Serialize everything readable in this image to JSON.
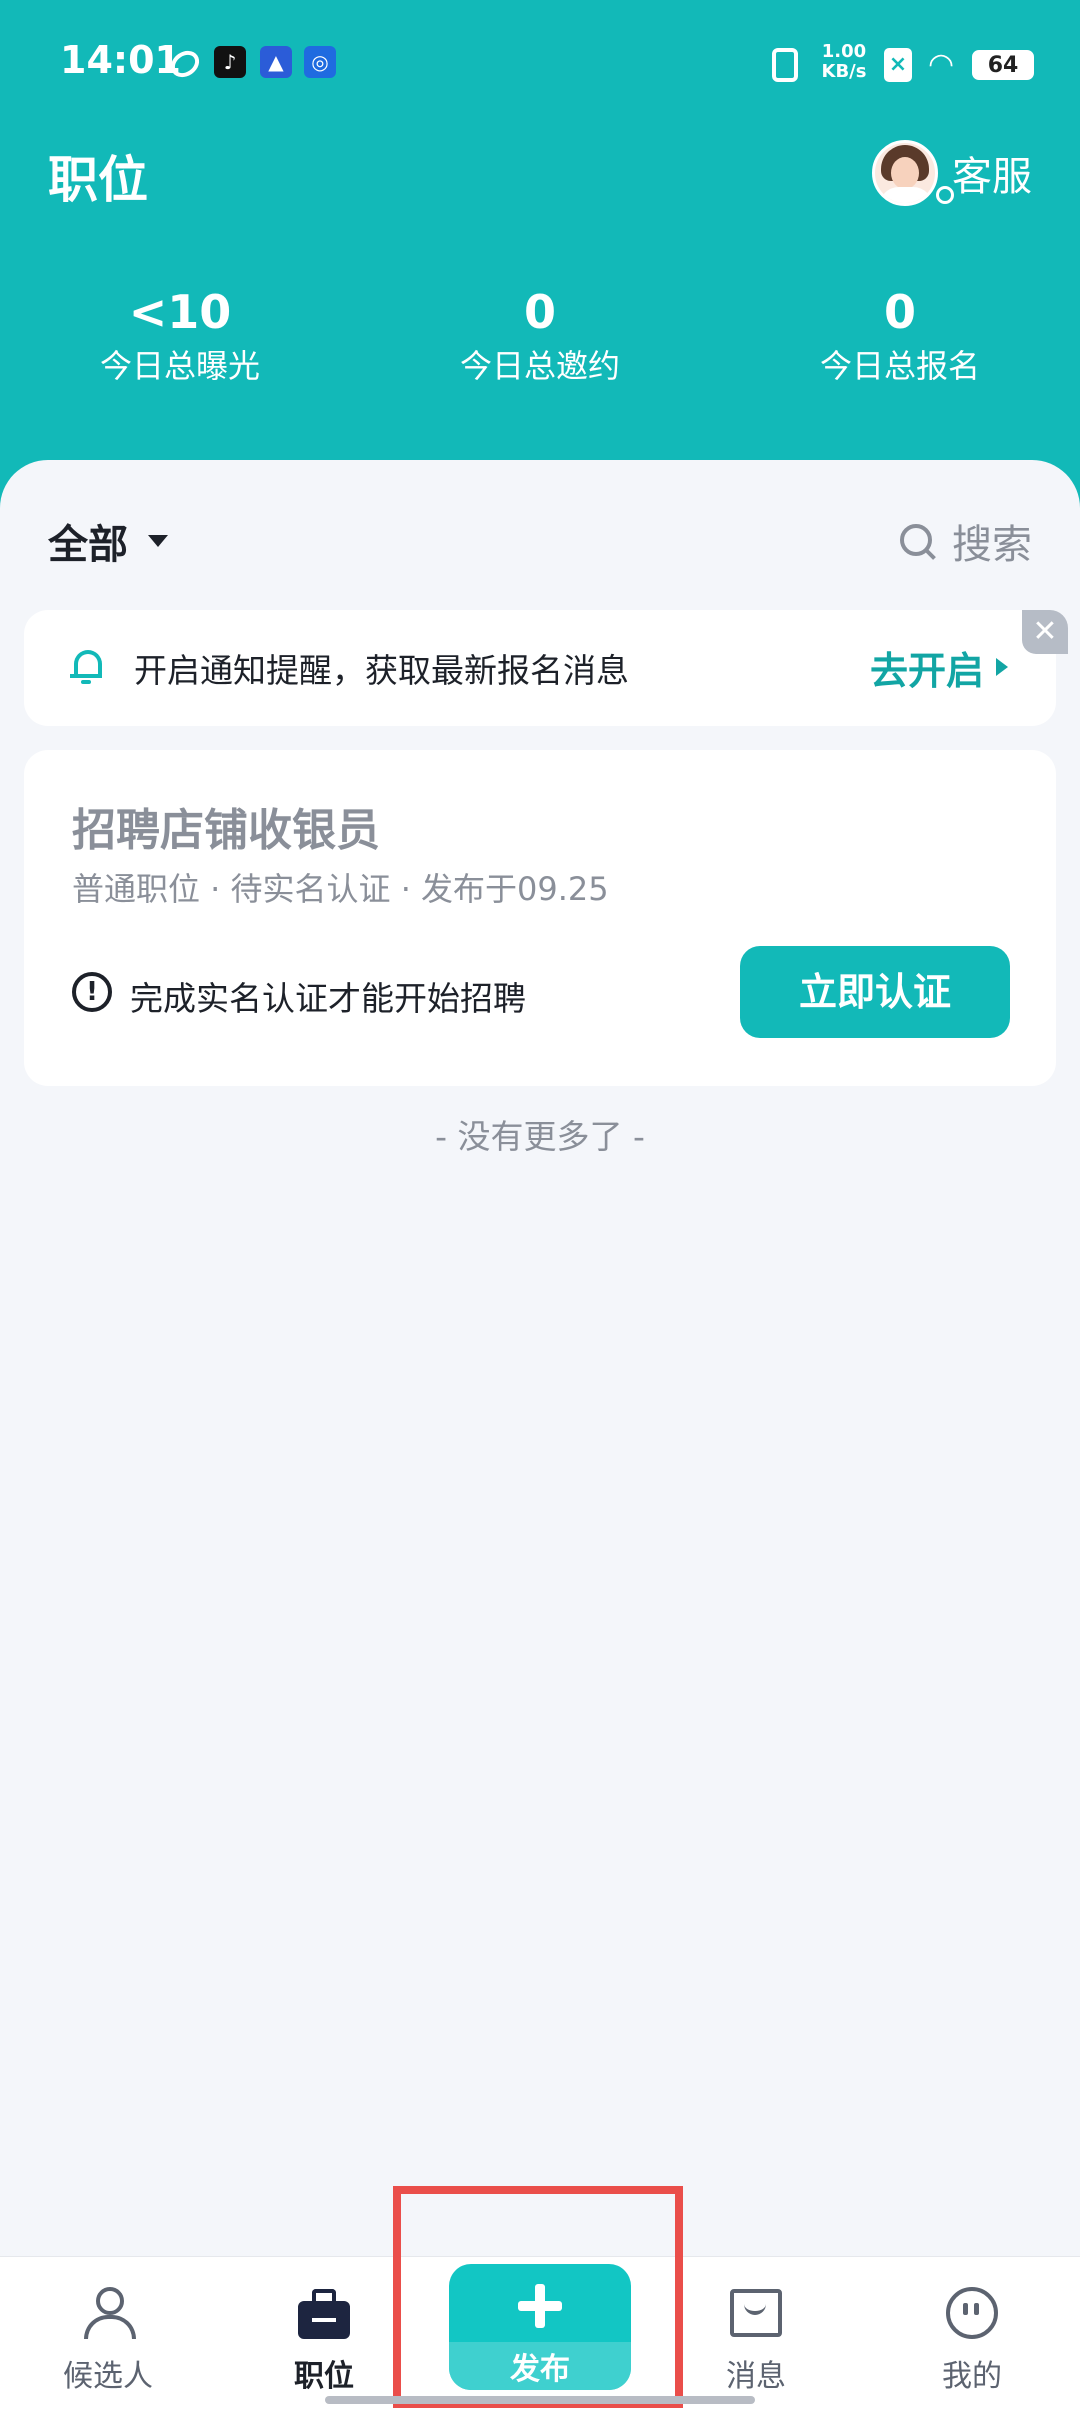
{
  "status_bar": {
    "time": "14:01",
    "speed": "1.00\nKB/s",
    "battery": "64",
    "apps": [
      "leaf-icon",
      "tiktok-icon",
      "bank-icon",
      "app-circle-icon"
    ]
  },
  "header": {
    "title": "职位",
    "service_label": "客服"
  },
  "stats": [
    {
      "value": "<10",
      "label": "今日总曝光"
    },
    {
      "value": "0",
      "label": "今日总邀约"
    },
    {
      "value": "0",
      "label": "今日总报名"
    }
  ],
  "filter": {
    "label": "全部",
    "search_label": "搜索"
  },
  "notice": {
    "text": "开启通知提醒，获取最新报名消息",
    "action": "去开启",
    "close": "✕"
  },
  "job": {
    "title": "招聘店铺收银员",
    "meta": "普通职位 · 待实名认证 · 发布于09.25",
    "warning": "完成实名认证才能开始招聘",
    "action": "立即认证"
  },
  "list_footer": "- 没有更多了 -",
  "tabbar": {
    "candidates": "候选人",
    "jobs": "职位",
    "publish": "发布",
    "messages": "消息",
    "me": "我的"
  },
  "colors": {
    "accent": "#12b9b8",
    "highlight": "#ea4e4a",
    "background": "#f4f6fa"
  }
}
